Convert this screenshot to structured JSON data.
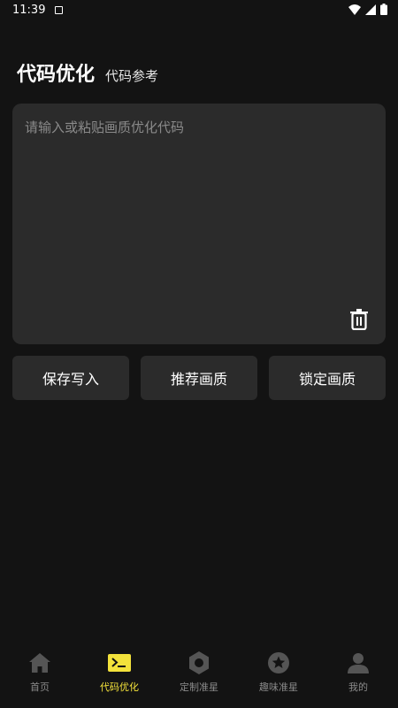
{
  "status": {
    "time": "11:39"
  },
  "header": {
    "title": "代码优化",
    "subtitle": "代码参考"
  },
  "editor": {
    "placeholder": "请输入或粘贴画质优化代码",
    "value": ""
  },
  "buttons": {
    "save": "保存写入",
    "recommend": "推荐画质",
    "lock": "锁定画质"
  },
  "nav": {
    "active": 1,
    "accent": "#f3e23b",
    "items": [
      {
        "label": "首页",
        "icon": "home-icon"
      },
      {
        "label": "代码优化",
        "icon": "terminal-icon"
      },
      {
        "label": "定制准星",
        "icon": "hex-nut-icon"
      },
      {
        "label": "趣味准星",
        "icon": "star-circle-icon"
      },
      {
        "label": "我的",
        "icon": "person-icon"
      }
    ]
  }
}
